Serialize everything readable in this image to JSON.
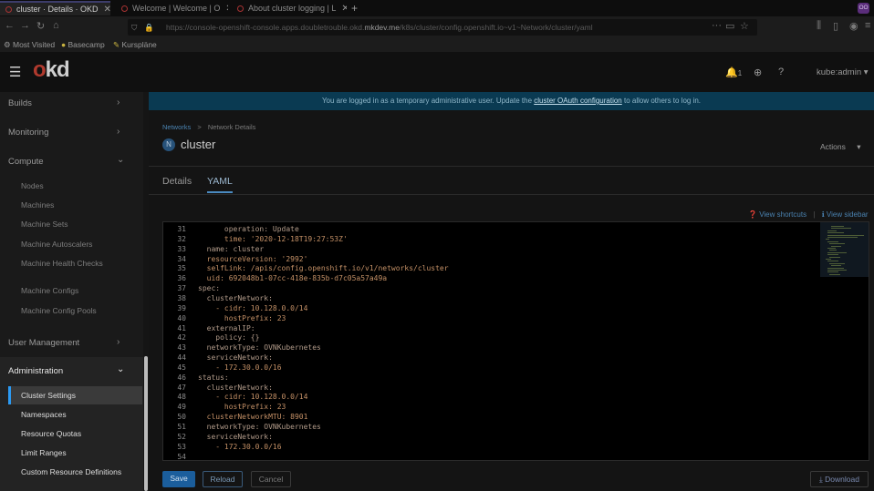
{
  "browser": {
    "tabs": [
      {
        "label": "cluster · Details · OKD"
      },
      {
        "label": "Welcome | Welcome | O"
      },
      {
        "label": "About cluster logging | L"
      }
    ],
    "url_prefix": "https://console-openshift-console.apps.doubletrouble.okd.",
    "url_host": "mkdev.me",
    "url_path": "/k8s/cluster/config.openshift.io~v1~Network/cluster/yaml",
    "bookmarks": [
      "Most Visited",
      "Basecamp",
      "Kurspläne"
    ],
    "avatar": "OO"
  },
  "header": {
    "logo_o": "o",
    "logo_kd": "kd",
    "notification_count": "1",
    "user": "kube:admin"
  },
  "banner": {
    "text_before": "You are logged in as a temporary administrative user. Update the",
    "link": "cluster OAuth configuration",
    "text_after": "to allow others to log in."
  },
  "sidebar": {
    "sections": [
      {
        "label": "Builds"
      },
      {
        "label": "Monitoring"
      },
      {
        "label": "Compute"
      },
      {
        "label": "User Management"
      },
      {
        "label": "Administration"
      }
    ],
    "compute_items": [
      "Nodes",
      "Machines",
      "Machine Sets",
      "Machine Autoscalers",
      "Machine Health Checks",
      "Machine Configs",
      "Machine Config Pools"
    ],
    "admin_items": [
      "Cluster Settings",
      "Namespaces",
      "Resource Quotas",
      "Limit Ranges",
      "Custom Resource Definitions"
    ]
  },
  "page": {
    "breadcrumb_link": "Networks",
    "breadcrumb_sep": ">",
    "breadcrumb_current": "Network Details",
    "badge": "N",
    "title": "cluster",
    "actions": "Actions",
    "tabs": [
      "Details",
      "YAML"
    ],
    "view_shortcuts": "View shortcuts",
    "view_sidebar": "View sidebar"
  },
  "editor": {
    "lines": [
      {
        "n": "31",
        "text": "      operation: Update"
      },
      {
        "n": "32",
        "text": "      time: '2020-12-18T19:27:53Z'"
      },
      {
        "n": "33",
        "text": "  name: cluster"
      },
      {
        "n": "34",
        "text": "  resourceVersion: '2992'"
      },
      {
        "n": "35",
        "text": "  selfLink: /apis/config.openshift.io/v1/networks/cluster"
      },
      {
        "n": "36",
        "text": "  uid: 692048b1-07cc-418e-835b-d7c05a57a49a"
      },
      {
        "n": "37",
        "text": "spec:"
      },
      {
        "n": "38",
        "text": "  clusterNetwork:"
      },
      {
        "n": "39",
        "text": "    - cidr: 10.128.0.0/14"
      },
      {
        "n": "40",
        "text": "      hostPrefix: 23"
      },
      {
        "n": "41",
        "text": "  externalIP:"
      },
      {
        "n": "42",
        "text": "    policy: {}"
      },
      {
        "n": "43",
        "text": "  networkType: OVNKubernetes"
      },
      {
        "n": "44",
        "text": "  serviceNetwork:"
      },
      {
        "n": "45",
        "text": "    - 172.30.0.0/16"
      },
      {
        "n": "46",
        "text": "status:"
      },
      {
        "n": "47",
        "text": "  clusterNetwork:"
      },
      {
        "n": "48",
        "text": "    - cidr: 10.128.0.0/14"
      },
      {
        "n": "49",
        "text": "      hostPrefix: 23"
      },
      {
        "n": "50",
        "text": "  clusterNetworkMTU: 8901"
      },
      {
        "n": "51",
        "text": "  networkType: OVNKubernetes"
      },
      {
        "n": "52",
        "text": "  serviceNetwork:"
      },
      {
        "n": "53",
        "text": "    - 172.30.0.0/16"
      },
      {
        "n": "54",
        "text": ""
      }
    ]
  },
  "footer": {
    "save": "Save",
    "reload": "Reload",
    "cancel": "Cancel",
    "download": "Download"
  }
}
